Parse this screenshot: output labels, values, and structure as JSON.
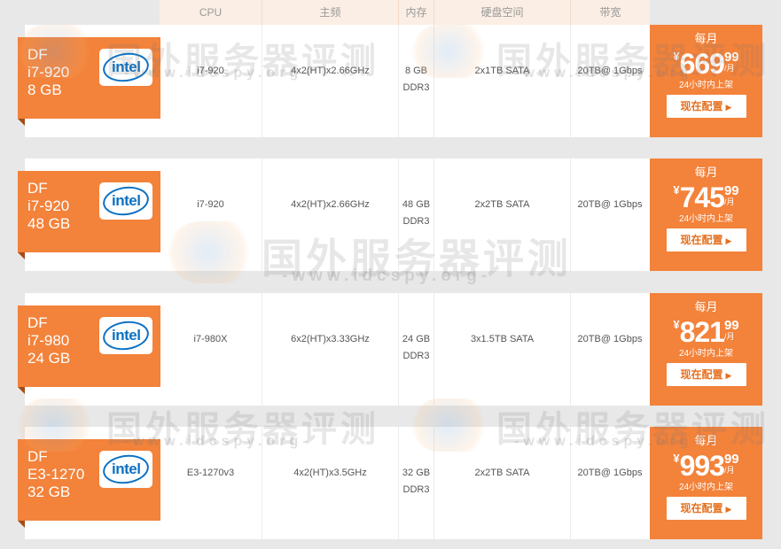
{
  "headers": [
    "CPU",
    "主频",
    "内存",
    "硬盘空间",
    "带宽"
  ],
  "watermark": {
    "text": "国外服务器评测",
    "sub": "-www.idcspy.org-"
  },
  "plans": [
    {
      "ribbon": [
        "DF",
        "i7-920",
        "8 GB"
      ],
      "brand": "intel",
      "cpu": "i7-920",
      "freq": "4x2(HT)x2.66GHz",
      "mem": "8 GB DDR3",
      "disk": "2x1TB SATA",
      "bw": "20TB@ 1Gbps",
      "price": {
        "per": "每月",
        "currency": "¥",
        "int": "669",
        "dec": "99",
        "unit": "/月",
        "ship": "24小时内上架",
        "button": "现在配置"
      }
    },
    {
      "ribbon": [
        "DF",
        "i7-920",
        "48 GB"
      ],
      "brand": "intel",
      "cpu": "i7-920",
      "freq": "4x2(HT)x2.66GHz",
      "mem": "48 GB DDR3",
      "disk": "2x2TB SATA",
      "bw": "20TB@ 1Gbps",
      "price": {
        "per": "每月",
        "currency": "¥",
        "int": "745",
        "dec": "99",
        "unit": "/月",
        "ship": "24小时内上架",
        "button": "现在配置"
      }
    },
    {
      "ribbon": [
        "DF",
        "i7-980",
        "24 GB"
      ],
      "brand": "intel",
      "cpu": "i7-980X",
      "freq": "6x2(HT)x3.33GHz",
      "mem": "24 GB DDR3",
      "disk": "3x1.5TB SATA",
      "bw": "20TB@ 1Gbps",
      "price": {
        "per": "每月",
        "currency": "¥",
        "int": "821",
        "dec": "99",
        "unit": "/月",
        "ship": "24小时内上架",
        "button": "现在配置"
      }
    },
    {
      "ribbon": [
        "DF",
        "E3-1270",
        "32 GB"
      ],
      "brand": "intel",
      "cpu": "E3-1270v3",
      "freq": "4x2(HT)x3.5GHz",
      "mem": "32 GB DDR3",
      "disk": "2x2TB SATA",
      "bw": "20TB@ 1Gbps",
      "price": {
        "per": "每月",
        "currency": "¥",
        "int": "993",
        "dec": "99",
        "unit": "/月",
        "ship": "24小时内上架",
        "button": "现在配置"
      }
    }
  ]
}
